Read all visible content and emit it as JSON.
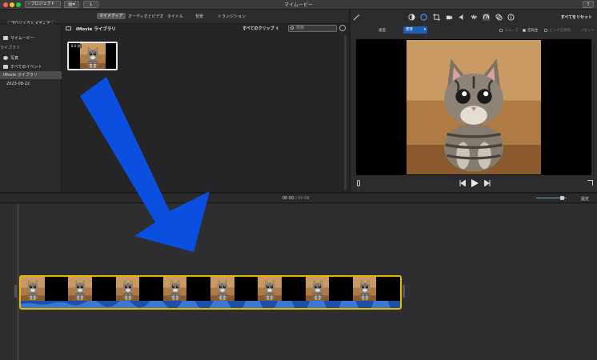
{
  "window": {
    "title": "マイムービー",
    "back_button": "プロジェクト"
  },
  "media_tabs": {
    "project_media_label": "プロジェクトメディア",
    "tabs": [
      {
        "label": "マイメディア",
        "active": true
      },
      {
        "label": "オーディオとビデオ",
        "active": false
      },
      {
        "label": "タイトル",
        "active": false
      },
      {
        "label": "背景",
        "active": false
      },
      {
        "label": "トランジション",
        "active": false
      }
    ]
  },
  "sidebar": {
    "items": [
      {
        "label": "マイムービー",
        "type": "item"
      },
      {
        "label": "ライブラリ",
        "type": "section"
      },
      {
        "label": "写真",
        "type": "item"
      },
      {
        "label": "すべてのイベント",
        "type": "item"
      },
      {
        "label": "iMovie ライブラリ",
        "type": "library",
        "selected": true
      },
      {
        "label": "2023-08-22",
        "type": "event"
      }
    ]
  },
  "browser": {
    "title": "iMovie ライブラリ",
    "filter": "すべてのクリップ",
    "search_placeholder": "検索",
    "clip": {
      "duration": "8.0 秒"
    }
  },
  "viewer": {
    "reset_all": "すべてをリセット",
    "speed_label": "速度:",
    "speed_value": "標準",
    "options": [
      {
        "label": "スムーズ",
        "checked": false
      },
      {
        "label": "逆再生",
        "checked": true
      },
      {
        "label": "ピッチを保持",
        "checked": false
      }
    ],
    "reset": "リセット"
  },
  "timeline": {
    "current_time": "00:00",
    "separator": "/",
    "total_time": "00:08",
    "settings": "設定",
    "frame_count": 16
  },
  "colors": {
    "accent_blue": "#1d5fb4",
    "clip_border": "#e6b800",
    "annotation_arrow": "#0a4fe0"
  }
}
